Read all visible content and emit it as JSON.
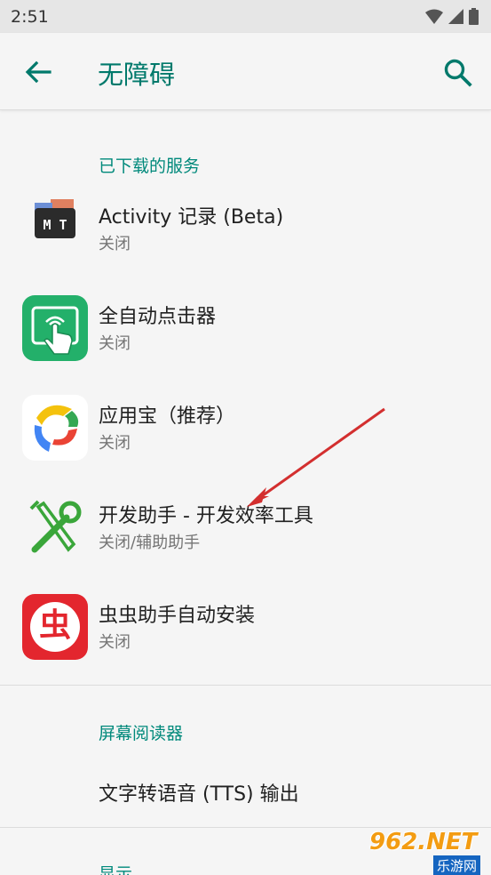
{
  "status_bar": {
    "time": "2:51"
  },
  "app_bar": {
    "title": "无障碍"
  },
  "sections": {
    "downloaded": "已下载的服务",
    "screen_reader": "屏幕阅读器",
    "display": "显示"
  },
  "services": [
    {
      "title": "Activity 记录 (Beta)",
      "status": "关闭",
      "icon": "mt-manager-icon"
    },
    {
      "title": "全自动点击器",
      "status": "关闭",
      "icon": "auto-clicker-icon"
    },
    {
      "title": "应用宝（推荐）",
      "status": "关闭",
      "icon": "yingyongbao-icon"
    },
    {
      "title": "开发助手 - 开发效率工具",
      "status": "关闭/辅助助手",
      "icon": "wrench-screwdriver-icon"
    },
    {
      "title": "虫虫助手自动安装",
      "status": "关闭",
      "icon": "chongchong-icon"
    }
  ],
  "screen_reader_items": [
    {
      "title": "文字转语音 (TTS) 输出"
    }
  ],
  "icon_glyphs": {
    "mt": "M T",
    "chong": "虫"
  },
  "watermark": {
    "brand": "962.NET",
    "sub": "乐游网"
  },
  "colors": {
    "accent": "#00796b",
    "section": "#00897b",
    "annotation_arrow": "#d32f2f"
  }
}
